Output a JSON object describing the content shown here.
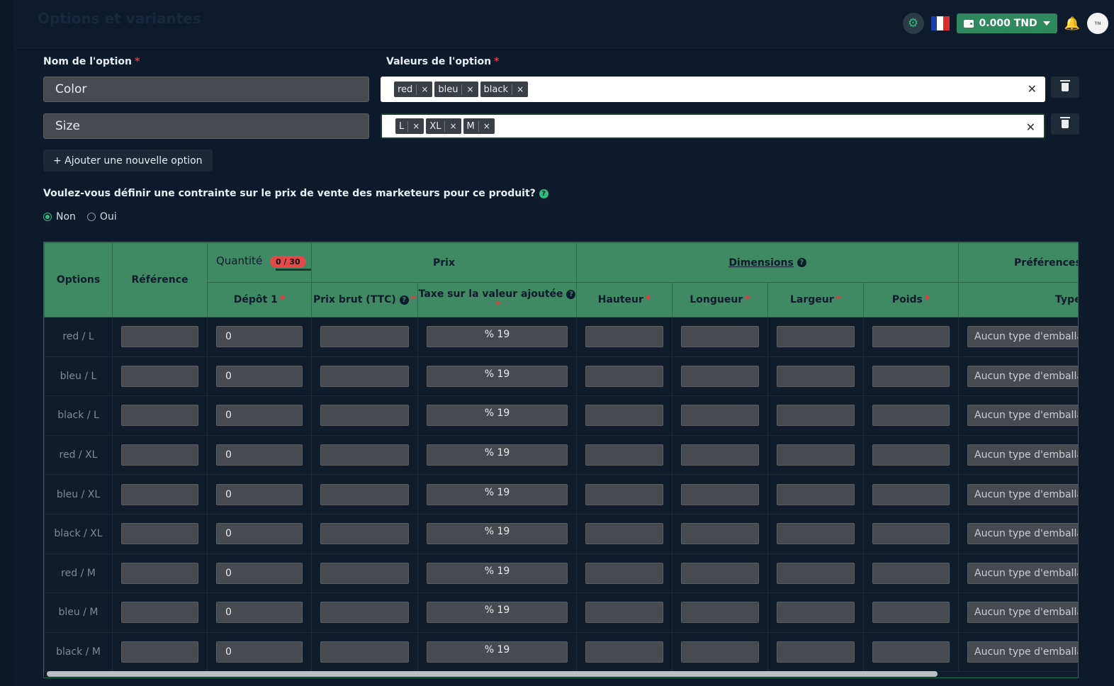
{
  "page": {
    "title": "Options et variantes"
  },
  "topbar": {
    "wallet_amount": "0.000 TND",
    "avatar_text": "TN"
  },
  "options_form": {
    "name_label": "Nom de l'option",
    "values_label": "Valeurs de l'option",
    "rows": [
      {
        "name": "Color",
        "values": [
          "red",
          "bleu",
          "black"
        ]
      },
      {
        "name": "Size",
        "values": [
          "L",
          "XL",
          "M"
        ]
      }
    ],
    "add_option_label": "+ Ajouter une nouvelle option"
  },
  "price_constraint": {
    "question": "Voulez-vous définir une contrainte sur le prix de vente des marketeurs pour ce produit?",
    "options": [
      "Non",
      "Oui"
    ],
    "selected": "Non"
  },
  "table": {
    "headers": {
      "options": "Options",
      "reference": "Référence",
      "quantite": "Quantité",
      "quantite_badge": "0 / 30",
      "prix": "Prix",
      "dimensions": "Dimensions",
      "preferences": "Préférences d",
      "depot": "Dépôt 1",
      "prix_brut": "Prix brut (TTC)",
      "tva": "Taxe sur la valeur ajoutée",
      "hauteur": "Hauteur",
      "longueur": "Longueur",
      "largeur": "Largeur",
      "poids": "Poids",
      "type": "Type"
    },
    "rows": [
      {
        "option": "red / L",
        "depot": "0",
        "tva": "% 19",
        "pack": "Aucun type d'emballage"
      },
      {
        "option": "bleu / L",
        "depot": "0",
        "tva": "% 19",
        "pack": "Aucun type d'emballage"
      },
      {
        "option": "black / L",
        "depot": "0",
        "tva": "% 19",
        "pack": "Aucun type d'emballage"
      },
      {
        "option": "red / XL",
        "depot": "0",
        "tva": "% 19",
        "pack": "Aucun type d'emballage"
      },
      {
        "option": "bleu / XL",
        "depot": "0",
        "tva": "% 19",
        "pack": "Aucun type d'emballage"
      },
      {
        "option": "black / XL",
        "depot": "0",
        "tva": "% 19",
        "pack": "Aucun type d'emballage"
      },
      {
        "option": "red / M",
        "depot": "0",
        "tva": "% 19",
        "pack": "Aucun type d'emballage"
      },
      {
        "option": "bleu / M",
        "depot": "0",
        "tva": "% 19",
        "pack": "Aucun type d'emballage"
      },
      {
        "option": "black / M",
        "depot": "0",
        "tva": "% 19",
        "pack": "Aucun type d'emballage"
      }
    ]
  },
  "colors": {
    "accent": "#3f8a64",
    "required": "#e23b3b",
    "badge": "#e24a4a"
  }
}
